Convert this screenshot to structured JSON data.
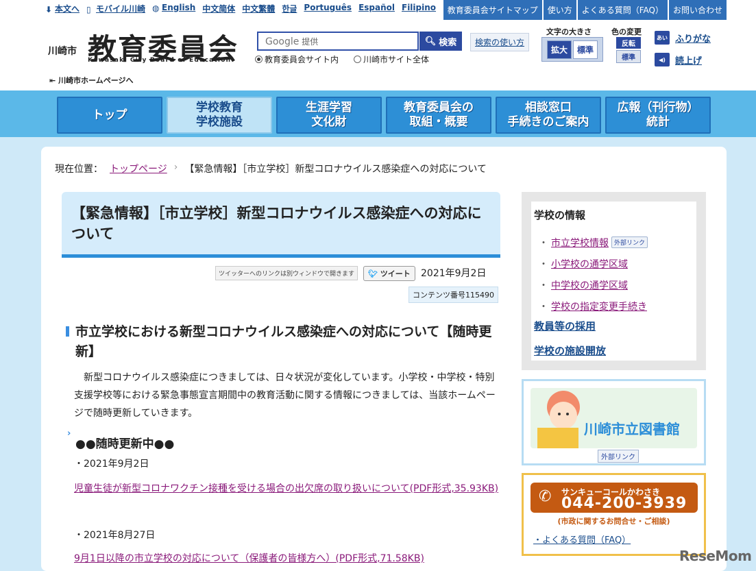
{
  "langbar": {
    "items": [
      "本文へ",
      "モバイル川崎",
      "English",
      "中文简体",
      "中文繁體",
      "한글",
      "Português",
      "Español",
      "Filipino"
    ]
  },
  "utilbar": {
    "items": [
      "教育委員会サイトマップ",
      "使い方",
      "よくある質問（FAQ）",
      "お問い合わせ"
    ]
  },
  "logo": {
    "city": "川崎市",
    "main": "教育委員会",
    "sub": "Kawasaki City Board of Education",
    "home_link": "川崎市ホームページへ"
  },
  "search": {
    "placeholder_brand": "Google",
    "placeholder_suffix": "提供",
    "button": "検索",
    "radio_1": "教育委員会サイト内",
    "radio_2": "川崎市サイト全体",
    "help": "検索の使い方"
  },
  "tools": {
    "font_size_label": "文字の大きさ",
    "font_enlarge": "拡大",
    "font_standard": "標準",
    "color_label": "色の変更",
    "color_invert": "反転",
    "color_standard": "標準",
    "furigana": "ふりがな",
    "read_aloud": "読上げ"
  },
  "nav": {
    "items": [
      {
        "label": "トップ"
      },
      {
        "label": "学校教育\n学校施設"
      },
      {
        "label": "生涯学習\n文化財"
      },
      {
        "label": "教育委員会の\n取組・概要"
      },
      {
        "label": "相談窓口\n手続きのご案内"
      },
      {
        "label": "広報（刊行物）\n統計"
      }
    ]
  },
  "breadcrumb": {
    "label": "現在位置：",
    "home": "トップページ",
    "sep": "›",
    "current": "【緊急情報】［市立学校］新型コロナウイルス感染症への対応について"
  },
  "article": {
    "title": "【緊急情報】［市立学校］新型コロナウイルス感染症への対応について",
    "share_note": "ツイッターへのリンクは別ウィンドウで開きます",
    "tweet": "ツイート",
    "date": "2021年9月2日",
    "contents_no": "コンテンツ番号115490",
    "heading": "市立学校における新型コロナウイルス感染症への対応について【随時更新】",
    "body": "　新型コロナウイルス感染症につきましては、日々状況が変化しています。小学校・中学校・特別支援学校等における緊急事態宣言期間中の教育活動に関する情報につきましては、当該ホームページで随時更新していきます。",
    "sub_heading": "●●随時更新中●●",
    "entries": [
      {
        "date": "・2021年9月2日",
        "link": "児童生徒が新型コロナワクチン接種を受ける場合の出欠席の取り扱いについて(PDF形式,35.93KB)"
      },
      {
        "date": "・2021年8月27日",
        "link": "9月1日以降の市立学校の対応について（保護者の皆様方へ）(PDF形式,71.58KB)"
      }
    ]
  },
  "sidebar": {
    "head": "学校の情報",
    "items": [
      {
        "label": "市立学校情報",
        "badge": "外部リンク"
      },
      {
        "label": "小学校の通学区域"
      },
      {
        "label": "中学校の通学区域"
      },
      {
        "label": "学校の指定変更手続き"
      }
    ],
    "recruit": "教員等の採用",
    "facility": "学校の施設開放",
    "library_banner": "川崎市立図書館",
    "library_ext": "外部リンク",
    "callcenter_name": "サンキューコールかわさき",
    "callcenter_number": "044-200-3939",
    "callcenter_sub": "(市政に関するお問合せ・ご相談)",
    "faq": "よくある質問（FAQ）"
  },
  "watermark": "ReseMom",
  "colors": {
    "nav_blue": "#2d8fd6",
    "band_blue": "#5bb8e8",
    "link_purple": "#8a1a7a",
    "accent_orange": "#c45a12"
  }
}
